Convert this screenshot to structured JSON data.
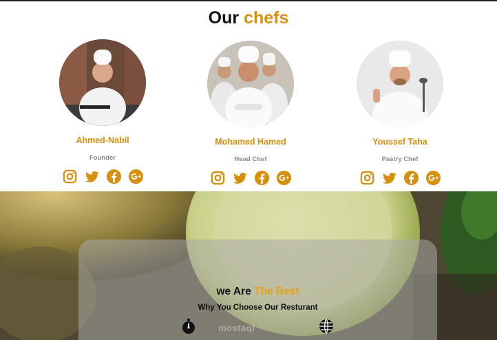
{
  "chefs_section": {
    "title_prefix": "Our",
    "title_accent": "chefs",
    "chefs": [
      {
        "name": "Ahmed-Nabil",
        "role": "Founder"
      },
      {
        "name": "Mohamed Hamed",
        "role": "Head Chef"
      },
      {
        "name": "Youssef Taha",
        "role": "Pastry Chef"
      }
    ],
    "social_icons": [
      "instagram-icon",
      "twitter-icon",
      "facebook-icon",
      "google-plus-icon"
    ]
  },
  "why_section": {
    "title_prefix": "we Are",
    "title_accent": "The Best",
    "subtitle": "Why You Choose Our Resturant",
    "feature_icons": [
      "stopwatch-icon",
      "globe-icon"
    ],
    "watermark": "mostaql"
  },
  "colors": {
    "accent": "#d78f0e",
    "accent_light": "#e8a020",
    "text": "#111111",
    "muted": "#888888"
  }
}
